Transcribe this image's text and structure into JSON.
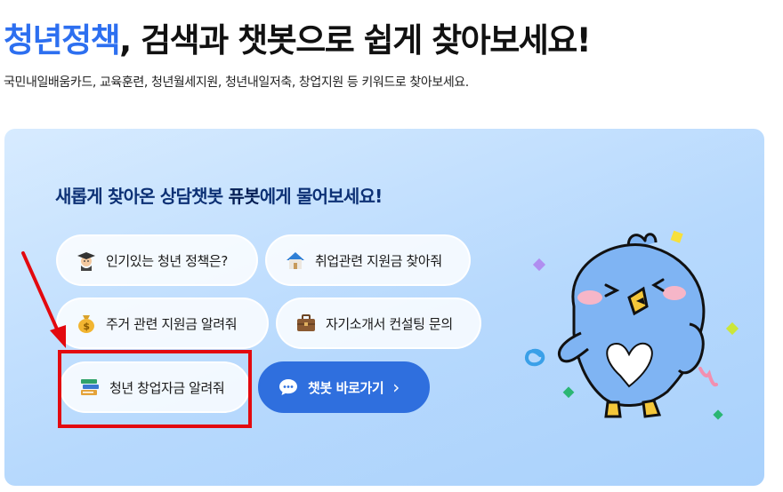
{
  "header": {
    "title_accent": "청년정책",
    "title_rest": ", 검색과 챗봇으로 쉽게 찾아보세요!",
    "subtitle": "국민내일배움카드, 교육훈련, 청년월세지원, 청년내일저축, 창업지원 등 키워드로 찾아보세요."
  },
  "chatbot_card": {
    "heading_pre": "새롭게 찾아온 상담챗봇 ",
    "heading_bot": "퓨봇",
    "heading_post": "에게 물어보세요!",
    "chips": [
      {
        "label": "인기있는 청년 정책은?",
        "icon": "graduate-icon"
      },
      {
        "label": "취업관련 지원금 찾아줘",
        "icon": "house-icon"
      },
      {
        "label": "주거 관련 지원금 알려줘",
        "icon": "money-bag-icon"
      },
      {
        "label": "자기소개서 컨설팅 문의",
        "icon": "briefcase-icon"
      },
      {
        "label": "청년 창업자금 알려줘",
        "icon": "books-icon"
      }
    ],
    "chatbot_button": {
      "label": "챗봇 바로가기",
      "icon": "chat-bubble-icon",
      "chevron": "›"
    }
  },
  "colors": {
    "accent": "#2d6ff0",
    "highlight": "#e3090f",
    "button": "#2f6fde"
  }
}
